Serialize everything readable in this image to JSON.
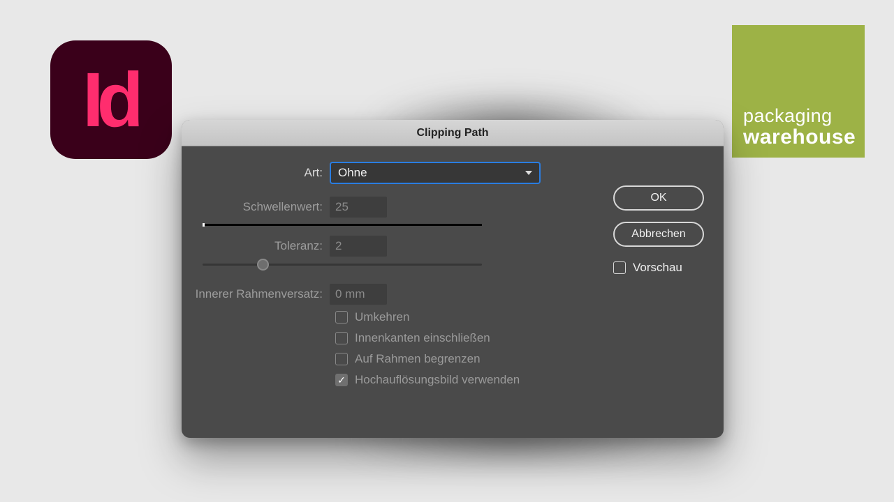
{
  "branding": {
    "app_icon_letters_i": "I",
    "app_icon_letters_d": "d",
    "logo_line1": "packaging",
    "logo_line2": "warehouse"
  },
  "dialog": {
    "title": "Clipping Path",
    "labels": {
      "art": "Art:",
      "schwellenwert": "Schwellenwert:",
      "toleranz": "Toleranz:",
      "innerer": "Innerer Rahmenversatz:"
    },
    "art_value": "Ohne",
    "schwellenwert_value": "25",
    "toleranz_value": "2",
    "innerer_value": "0 mm",
    "checks": {
      "umkehren": "Umkehren",
      "innenkanten": "Innenkanten einschließen",
      "auf_rahmen": "Auf Rahmen begrenzen",
      "hochaufloesung": "Hochauflösungsbild verwenden"
    },
    "buttons": {
      "ok": "OK",
      "cancel": "Abbrechen",
      "preview": "Vorschau"
    }
  }
}
